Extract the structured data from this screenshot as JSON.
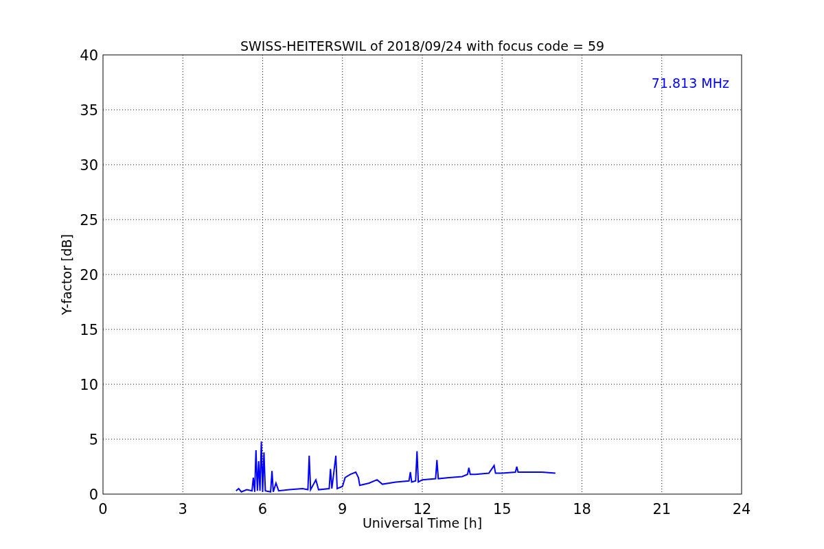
{
  "figure": {
    "chart_data": {
      "type": "line",
      "title": "SWISS-HEITERSWIL of 2018/09/24 with focus code = 59",
      "xlabel": "Universal Time [h]",
      "ylabel": "Y-factor [dB]",
      "x": [
        5.0,
        5.1,
        5.2,
        5.4,
        5.6,
        5.65,
        5.7,
        5.75,
        5.8,
        5.85,
        5.9,
        5.95,
        6.0,
        6.05,
        6.1,
        6.3,
        6.35,
        6.4,
        6.5,
        6.6,
        7.0,
        7.5,
        7.7,
        7.75,
        7.8,
        8.0,
        8.1,
        8.5,
        8.55,
        8.6,
        8.75,
        8.8,
        9.0,
        9.1,
        9.3,
        9.5,
        9.6,
        9.65,
        10.0,
        10.3,
        10.5,
        11.0,
        11.5,
        11.55,
        11.6,
        11.75,
        11.8,
        11.85,
        12.0,
        12.5,
        12.55,
        12.6,
        13.0,
        13.5,
        13.7,
        13.75,
        13.8,
        14.0,
        14.5,
        14.7,
        14.75,
        15.0,
        15.5,
        15.55,
        15.6,
        16.0,
        16.5,
        17.0
      ],
      "series": [
        {
          "color": "#0000ff",
          "values": [
            0.3,
            0.5,
            0.2,
            0.4,
            0.3,
            1.5,
            0.2,
            4.0,
            0.3,
            3.0,
            0.3,
            4.8,
            0.2,
            3.8,
            0.3,
            0.2,
            2.1,
            0.2,
            1.0,
            0.3,
            0.4,
            0.5,
            0.4,
            3.5,
            0.4,
            1.3,
            0.4,
            0.5,
            2.3,
            0.5,
            3.5,
            0.5,
            0.7,
            1.5,
            1.8,
            2.0,
            1.5,
            0.8,
            1.0,
            1.3,
            0.9,
            1.1,
            1.2,
            2.0,
            1.1,
            1.2,
            3.9,
            1.1,
            1.3,
            1.4,
            3.1,
            1.4,
            1.5,
            1.6,
            1.8,
            2.4,
            1.8,
            1.8,
            1.9,
            2.6,
            1.9,
            1.9,
            2.0,
            2.5,
            2.0,
            2.0,
            2.0,
            1.9
          ]
        }
      ],
      "xlim": [
        0,
        24
      ],
      "ylim": [
        0,
        40
      ],
      "xticks": [
        0,
        3,
        6,
        9,
        12,
        15,
        18,
        21,
        24
      ],
      "yticks": [
        0,
        5,
        10,
        15,
        20,
        25,
        30,
        35,
        40
      ],
      "grid": true,
      "annotations": [
        "71.813 MHz"
      ]
    }
  }
}
